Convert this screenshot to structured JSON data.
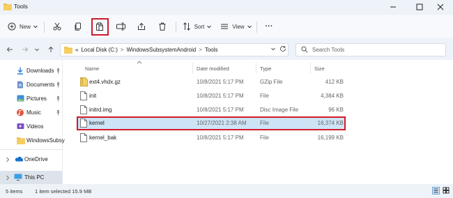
{
  "window": {
    "title": "Tools"
  },
  "toolbar": {
    "new_label": "New",
    "sort_label": "Sort",
    "view_label": "View",
    "more_label": "···"
  },
  "address": {
    "overflow": "«",
    "crumbs": [
      "Local Disk (C:)",
      "WindowsSubsystemAndroid",
      "Tools"
    ],
    "separator": ">"
  },
  "search": {
    "placeholder": "Search Tools"
  },
  "sidebar": {
    "items": [
      {
        "label": "Downloads",
        "icon": "download-icon",
        "pinned": true
      },
      {
        "label": "Documents",
        "icon": "documents-icon",
        "pinned": true
      },
      {
        "label": "Pictures",
        "icon": "pictures-icon",
        "pinned": true
      },
      {
        "label": "Music",
        "icon": "music-icon",
        "pinned": true
      },
      {
        "label": "Videos",
        "icon": "videos-icon",
        "pinned": false
      },
      {
        "label": "WindowsSubsy",
        "icon": "folder-icon",
        "pinned": false
      },
      {
        "label": "OneDrive",
        "icon": "onedrive-icon",
        "pinned": false
      },
      {
        "label": "This PC",
        "icon": "computer-icon",
        "pinned": false
      }
    ]
  },
  "columns": [
    "Name",
    "Date modified",
    "Type",
    "Size"
  ],
  "files": [
    {
      "name": "ext4.vhdx.gz",
      "date": "10/8/2021 5:17 PM",
      "type": "GZip File",
      "size": "412 KB",
      "icon": "archive-icon"
    },
    {
      "name": "init",
      "date": "10/8/2021 5:17 PM",
      "type": "File",
      "size": "4,384 KB",
      "icon": "file-icon"
    },
    {
      "name": "initrd.img",
      "date": "10/8/2021 5:17 PM",
      "type": "Disc Image File",
      "size": "96 KB",
      "icon": "file-icon"
    },
    {
      "name": "kernel",
      "date": "10/27/2021 2:38 AM",
      "type": "File",
      "size": "16,374 KB",
      "icon": "file-icon",
      "selected": true
    },
    {
      "name": "kernel_bak",
      "date": "10/8/2021 5:17 PM",
      "type": "File",
      "size": "16,199 KB",
      "icon": "file-icon"
    }
  ],
  "status": {
    "count": "5 items",
    "selection": "1 item selected  15.9 MB"
  },
  "colors": {
    "highlight": "#d11a2a",
    "selection": "#cde4f7",
    "folder": "#f2c14e",
    "accent": "#0067c0"
  }
}
